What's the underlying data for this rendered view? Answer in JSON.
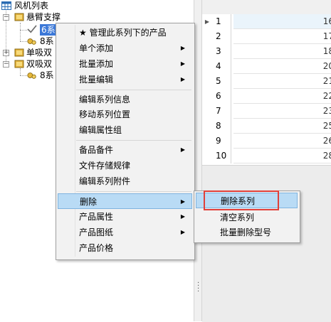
{
  "tree": {
    "root_label": "风机列表",
    "nodes": [
      {
        "label": "悬臂支撑"
      },
      {
        "label": "6系"
      },
      {
        "label": "8系"
      },
      {
        "label": "单吸双"
      },
      {
        "label": "双吸双"
      },
      {
        "label": "8系"
      }
    ]
  },
  "grid": {
    "rows": [
      {
        "num": "1",
        "value": "16"
      },
      {
        "num": "2",
        "value": "17"
      },
      {
        "num": "3",
        "value": "18"
      },
      {
        "num": "4",
        "value": "20"
      },
      {
        "num": "5",
        "value": "21"
      },
      {
        "num": "6",
        "value": "22"
      },
      {
        "num": "7",
        "value": "23"
      },
      {
        "num": "8",
        "value": "25"
      },
      {
        "num": "9",
        "value": "26"
      },
      {
        "num": "10",
        "value": "28"
      }
    ]
  },
  "context_menu": {
    "items": [
      {
        "label": "★ 管理此系列下的产品"
      },
      {
        "label": "单个添加"
      },
      {
        "label": "批量添加"
      },
      {
        "label": "批量编辑"
      },
      {
        "label": "编辑系列信息"
      },
      {
        "label": "移动系列位置"
      },
      {
        "label": "编辑属性组"
      },
      {
        "label": "备品备件"
      },
      {
        "label": "文件存储规律"
      },
      {
        "label": "编辑系列附件"
      },
      {
        "label": "删除"
      },
      {
        "label": "产品属性"
      },
      {
        "label": "产品图纸"
      },
      {
        "label": "产品价格"
      }
    ]
  },
  "submenu": {
    "items": [
      {
        "label": "删除系列"
      },
      {
        "label": "清空系列"
      },
      {
        "label": "批量删除型号"
      }
    ]
  },
  "colors": {
    "highlight": "#b9dbf5",
    "annotation_box": "#e0403a",
    "selected_row": "#eaf4fb"
  }
}
